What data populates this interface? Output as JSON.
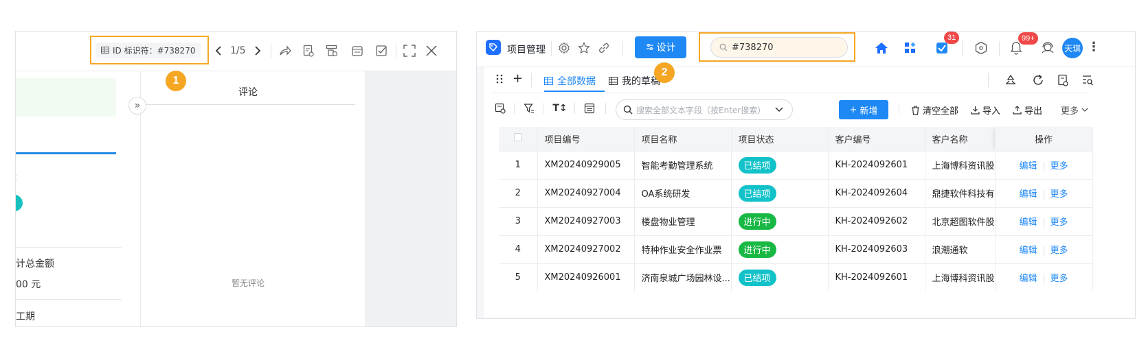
{
  "left_panel": {
    "id_chip": {
      "icon": "table-icon",
      "label": "ID 标识符：#738270"
    },
    "callout_1": "1",
    "pager": "1/5",
    "comment_title": "评论",
    "empty_comment": "暂无评论",
    "fragments": {
      "colon_fragment": "：",
      "amount_label": "计总金额",
      "amount_value": "00 元",
      "period_label": "工期"
    }
  },
  "right_panel": {
    "app_name": "项目管理",
    "design_button": "设计",
    "search_value": "#738270",
    "callout_2": "2",
    "badges": {
      "todo": "31",
      "notify": "99+"
    },
    "avatar": "天琪",
    "tabs": [
      {
        "label": "全部数据",
        "active": true
      },
      {
        "label": "我的草稿",
        "active": false
      }
    ],
    "text_search_placeholder": "搜索全部文本字段（按Enter搜索）",
    "actions": {
      "new": "新增",
      "clear_all": "清空全部",
      "import": "导入",
      "export": "导出",
      "more": "更多"
    },
    "table": {
      "columns": [
        "项目编号",
        "项目名称",
        "项目状态",
        "客户编号",
        "客户名称",
        "操作"
      ],
      "rows": [
        {
          "idx": "1",
          "code": "XM20240929005",
          "name": "智能考勤管理系统",
          "status": "已结项",
          "status_kind": "done",
          "client_code": "KH-2024092601",
          "client_name": "上海博科资讯股"
        },
        {
          "idx": "2",
          "code": "XM20240927004",
          "name": "OA系统研发",
          "status": "已结项",
          "status_kind": "done",
          "client_code": "KH-2024092604",
          "client_name": "鼎捷软件科技有"
        },
        {
          "idx": "3",
          "code": "XM20240927003",
          "name": "楼盘物业管理",
          "status": "进行中",
          "status_kind": "running",
          "client_code": "KH-2024092602",
          "client_name": "北京超图软件股"
        },
        {
          "idx": "4",
          "code": "XM20240927002",
          "name": "特种作业安全作业票",
          "status": "进行中",
          "status_kind": "running",
          "client_code": "KH-2024092603",
          "client_name": "浪潮通软"
        },
        {
          "idx": "5",
          "code": "XM20240926001",
          "name": "济南泉城广场园林设...",
          "status": "已结项",
          "status_kind": "done",
          "client_code": "KH-2024092601",
          "client_name": "上海博科资讯股"
        }
      ],
      "op_edit": "编辑",
      "op_more": "更多"
    }
  },
  "colors": {
    "highlight": "#f5a623",
    "primary": "#1e88f5",
    "status_done": "#12c2c9",
    "status_running": "#18b844",
    "badge_red": "#f04848"
  }
}
